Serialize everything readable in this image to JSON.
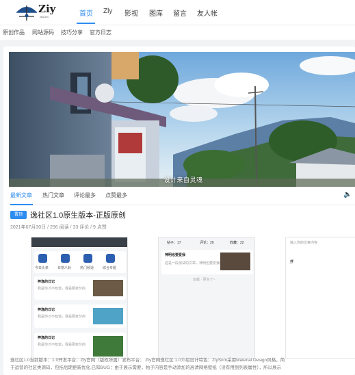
{
  "header": {
    "logo_text": "Ziy",
    "logo_sub": "ziyu.tm",
    "nav": [
      "首页",
      "Zly",
      "影视",
      "图库",
      "留言",
      "友人帐"
    ]
  },
  "subnav": [
    "原创作品",
    "网站源码",
    "技巧分享",
    "官方日志"
  ],
  "banner": {
    "caption": "设计来自灵魂"
  },
  "tabs": [
    "最新文章",
    "热门文章",
    "评论最多",
    "点赞最多"
  ],
  "post": {
    "badge": "置顶",
    "title": "逸社区1.0原生版本-正版原创",
    "meta": "2021年07月30日 / 256 阅读 / 33 评论 / 9 点赞",
    "excerpt_line1": "逸社区1.0当前版本：1.0开发平台：Zly官网（版权所属）发布平台： Zly官网逸社区 1.0介绍设计特色：ZlySnm采用Material Design风格，简",
    "excerpt_line2": "于运营的社区类源码，包括后期更新优化.已知BUG：由于展示需要，帖子内容是手动添加的高清网络壁纸（没有用到列表属性），所以展示"
  },
  "screens": {
    "s1": {
      "icons": [
        "今日头条",
        "日常八卦",
        "热门频道",
        "综合专题"
      ],
      "cards": [
        "梓逸的日记",
        "梓逸的日记",
        "梓逸的日记"
      ],
      "card_text": "我是你才不知道，我是那家伙的"
    },
    "s2": {
      "stats": [
        "帖子：17",
        "评论：20",
        "收藏：22"
      ],
      "card_title": "神明也要爱我",
      "card_text": "这是一段测试的文章，神明也要爱我的。",
      "more": "加载 · 更多了~"
    },
    "s3": {
      "placeholder": "输入你的文章内容",
      "hash": "#"
    }
  },
  "colors": {
    "accent": "#2d8cf0"
  }
}
